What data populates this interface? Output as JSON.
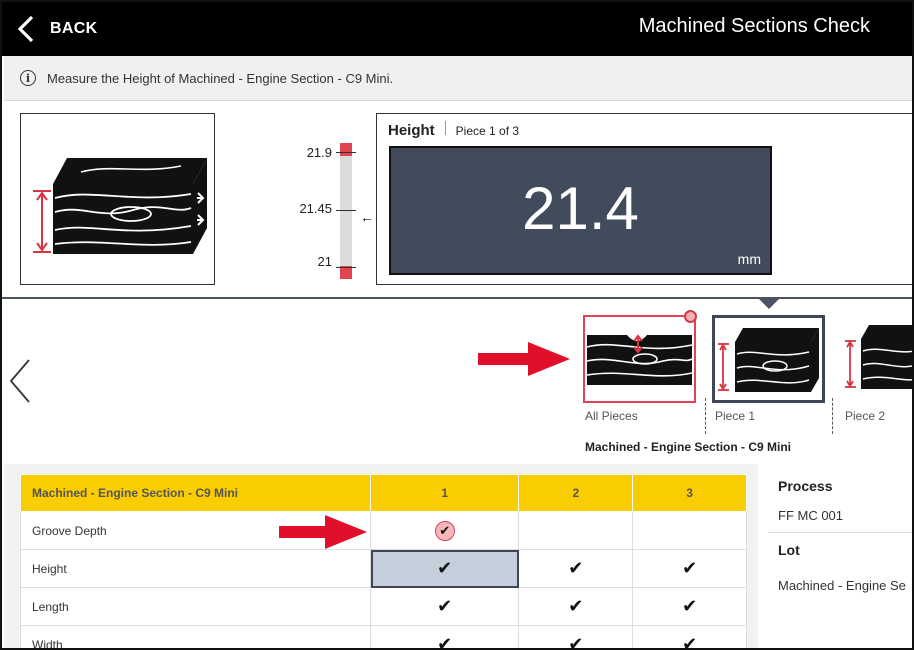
{
  "header": {
    "back_label": "BACK",
    "title": "Machined Sections Check"
  },
  "instruction": {
    "icon": "info-icon",
    "text": "Measure the Height of Machined - Engine Section - C9 Mini."
  },
  "gauge": {
    "max": "21.9",
    "target": "21.45",
    "min": "21"
  },
  "measurement": {
    "label": "Height",
    "piece": "Piece 1 of 3",
    "value": "21.4",
    "unit": "mm"
  },
  "pieces": {
    "items": [
      {
        "label": "All Pieces"
      },
      {
        "label": "Piece 1"
      },
      {
        "label": "Piece 2"
      }
    ],
    "caption": "Machined - Engine Section - C9 Mini"
  },
  "table": {
    "headers": [
      "Machined - Engine Section - C9 Mini",
      "1",
      "2",
      "3"
    ],
    "rows": [
      {
        "name": "Groove Depth",
        "cells": [
          "check-red",
          "",
          ""
        ]
      },
      {
        "name": "Height",
        "cells": [
          "check",
          "check",
          "check"
        ]
      },
      {
        "name": "Length",
        "cells": [
          "check",
          "check",
          "check"
        ]
      },
      {
        "name": "Width",
        "cells": [
          "check",
          "check",
          "check"
        ]
      }
    ]
  },
  "info": {
    "process_label": "Process",
    "process_value": "FF MC 001",
    "lot_label": "Lot",
    "lot_value": "Machined - Engine Se"
  },
  "colors": {
    "accent": "#f9cd00",
    "display": "#414b5b",
    "alert": "#e0444f"
  }
}
